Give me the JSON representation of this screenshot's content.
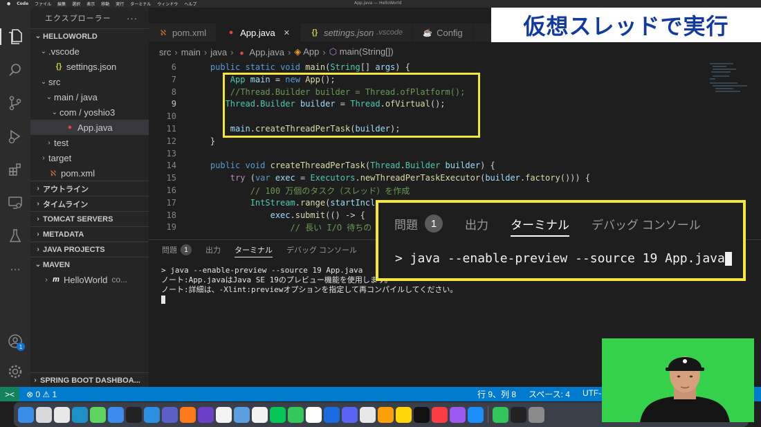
{
  "menubar": {
    "app": "Code",
    "items": [
      "ファイル",
      "編集",
      "選択",
      "表示",
      "移動",
      "実行",
      "ターミナル",
      "ウィンドウ",
      "ヘルプ"
    ],
    "window_title": "App.java — HelloWorld"
  },
  "title_overlay": "仮想スレッドで実行",
  "activity_bar": {
    "items": [
      "files-icon",
      "search-icon",
      "source-control-icon",
      "run-debug-icon",
      "extensions-icon",
      "remote-explorer-icon",
      "testing-icon",
      "more-icon"
    ],
    "account_badge": "1"
  },
  "sidebar": {
    "header": "エクスプローラー",
    "more": "···",
    "tree": [
      {
        "label": "HELLOWORLD",
        "chevron": "⌄",
        "indent": 0,
        "section": true
      },
      {
        "label": ".vscode",
        "chevron": "⌄",
        "indent": 1
      },
      {
        "label": "settings.json",
        "icon": "{}",
        "kind": "json",
        "indent": 2
      },
      {
        "label": "src",
        "chevron": "⌄",
        "indent": 1
      },
      {
        "label": "main / java",
        "chevron": "⌄",
        "indent": 2
      },
      {
        "label": "com / yoshio3",
        "chevron": "⌄",
        "indent": 3
      },
      {
        "label": "App.java",
        "icon": "●",
        "kind": "java",
        "indent": 4,
        "selected": true
      },
      {
        "label": "test",
        "chevron": "›",
        "indent": 2
      },
      {
        "label": "target",
        "chevron": "›",
        "indent": 1
      },
      {
        "label": "pom.xml",
        "icon": "ℵ",
        "kind": "xml",
        "indent": 1
      }
    ],
    "sections": [
      {
        "label": "アウトライン",
        "chevron": "›"
      },
      {
        "label": "タイムライン",
        "chevron": "›"
      },
      {
        "label": "TOMCAT SERVERS",
        "chevron": "›"
      },
      {
        "label": "METADATA",
        "chevron": "›"
      },
      {
        "label": "JAVA PROJECTS",
        "chevron": "›"
      },
      {
        "label": "MAVEN",
        "chevron": "⌄"
      }
    ],
    "maven_item": "HelloWorld",
    "maven_item_suffix": "co...",
    "bottom_section": "SPRING BOOT DASHBOA..."
  },
  "tabs": [
    {
      "label": "pom.xml",
      "icon": "ℵ",
      "kind": "xml"
    },
    {
      "label": "App.java",
      "icon": "●",
      "kind": "java",
      "active": true,
      "close": "✕"
    },
    {
      "label": "settings.json",
      "icon": "{}",
      "kind": "json",
      "suffix": ".vscode",
      "italic": true
    },
    {
      "label": "Config",
      "icon": "☕",
      "kind": "config"
    }
  ],
  "breadcrumb": [
    "src",
    "main",
    "java",
    "App.java",
    "App",
    "main(String[])"
  ],
  "code": {
    "lines": [
      {
        "n": "6",
        "indent": 4,
        "tokens": [
          [
            "kw",
            "public "
          ],
          [
            "kw",
            "static "
          ],
          [
            "kw",
            "void "
          ],
          [
            "fn",
            "main"
          ],
          [
            "tx",
            "("
          ],
          [
            "ty",
            "String"
          ],
          [
            "tx",
            "[] "
          ],
          [
            "va",
            "args"
          ],
          [
            "tx",
            ") {"
          ]
        ]
      },
      {
        "n": "7",
        "indent": 8,
        "tokens": [
          [
            "ty",
            "App "
          ],
          [
            "va",
            "main"
          ],
          [
            "tx",
            " = "
          ],
          [
            "kw",
            "new "
          ],
          [
            "fn",
            "App"
          ],
          [
            "tx",
            "();"
          ]
        ]
      },
      {
        "n": "8",
        "indent": 8,
        "tokens": [
          [
            "cm",
            "//Thread.Builder builder = Thread.ofPlatform();"
          ]
        ]
      },
      {
        "n": "9",
        "indent": 7,
        "cur": true,
        "tokens": [
          [
            "ty",
            "Thread"
          ],
          [
            "tx",
            "."
          ],
          [
            "ty",
            "Builder "
          ],
          [
            "va",
            "builder"
          ],
          [
            "tx",
            " = "
          ],
          [
            "ty",
            "Thread"
          ],
          [
            "tx",
            "."
          ],
          [
            "fn",
            "ofVirtual"
          ],
          [
            "tx",
            "();"
          ]
        ]
      },
      {
        "n": "10",
        "indent": 0,
        "tokens": []
      },
      {
        "n": "11",
        "indent": 8,
        "tokens": [
          [
            "va",
            "main"
          ],
          [
            "tx",
            "."
          ],
          [
            "fn",
            "createThreadPerTask"
          ],
          [
            "tx",
            "("
          ],
          [
            "va",
            "builder"
          ],
          [
            "tx",
            ");"
          ]
        ]
      },
      {
        "n": "12",
        "indent": 4,
        "tokens": [
          [
            "tx",
            "}"
          ]
        ]
      },
      {
        "n": "13",
        "indent": 0,
        "tokens": []
      },
      {
        "n": "14",
        "indent": 4,
        "tokens": [
          [
            "kw",
            "public "
          ],
          [
            "kw",
            "void "
          ],
          [
            "fn",
            "createThreadPerTask"
          ],
          [
            "tx",
            "("
          ],
          [
            "ty",
            "Thread"
          ],
          [
            "tx",
            "."
          ],
          [
            "ty",
            "Builder "
          ],
          [
            "va",
            "builder"
          ],
          [
            "tx",
            ") {"
          ]
        ]
      },
      {
        "n": "15",
        "indent": 8,
        "tokens": [
          [
            "kw2",
            "try "
          ],
          [
            "tx",
            "("
          ],
          [
            "kw",
            "var "
          ],
          [
            "va",
            "exec"
          ],
          [
            "tx",
            " = "
          ],
          [
            "ty",
            "Executors"
          ],
          [
            "tx",
            "."
          ],
          [
            "fn",
            "newThreadPerTaskExecutor"
          ],
          [
            "tx",
            "("
          ],
          [
            "va",
            "builder"
          ],
          [
            "tx",
            "."
          ],
          [
            "fn",
            "factory"
          ],
          [
            "tx",
            "())) {"
          ]
        ]
      },
      {
        "n": "16",
        "indent": 12,
        "tokens": [
          [
            "cm",
            "// 100 万個のタスク（スレッド）を作成"
          ]
        ]
      },
      {
        "n": "17",
        "indent": 12,
        "tokens": [
          [
            "ty",
            "IntStream"
          ],
          [
            "tx",
            "."
          ],
          [
            "fn",
            "range"
          ],
          [
            "tx",
            "("
          ],
          [
            "va",
            "startIncl"
          ]
        ]
      },
      {
        "n": "18",
        "indent": 16,
        "tokens": [
          [
            "va",
            "exec"
          ],
          [
            "tx",
            "."
          ],
          [
            "fn",
            "submit"
          ],
          [
            "tx",
            "(() -> {"
          ]
        ]
      },
      {
        "n": "19",
        "indent": 20,
        "tokens": [
          [
            "cm",
            "// 長い I/O 待ちの"
          ]
        ]
      }
    ]
  },
  "panel": {
    "tabs": [
      {
        "label": "問題",
        "badge": "1"
      },
      {
        "label": "出力"
      },
      {
        "label": "ターミナル",
        "active": true
      },
      {
        "label": "デバッグ コンソール"
      }
    ],
    "terminal_lines": [
      "> java --enable-preview --source 19 App.java",
      "ノート:App.javaはJava SE 19のプレビュー機能を使用します。",
      "ノート:詳細は、-Xlint:previewオプションを指定して再コンパイルしてください。"
    ]
  },
  "zoom": {
    "tabs": [
      {
        "label": "問題",
        "badge": "1"
      },
      {
        "label": "出力"
      },
      {
        "label": "ターミナル",
        "active": true
      },
      {
        "label": "デバッグ コンソール"
      }
    ],
    "command": "> java --enable-preview --source 19 App.java"
  },
  "status": {
    "remote": "><",
    "problems": "⊗ 0 ⚠ 1",
    "position": "行 9、列 8",
    "spaces": "スペース: 4",
    "encoding": "UTF-"
  },
  "dock": {
    "apps": [
      {
        "name": "finder",
        "color": "#3b8ee8"
      },
      {
        "name": "launchpad",
        "color": "#d8d8d8"
      },
      {
        "name": "chrome",
        "color": "#e8e8e8"
      },
      {
        "name": "edge",
        "color": "#1e90c8"
      },
      {
        "name": "messages",
        "color": "#5fd35f"
      },
      {
        "name": "mail",
        "color": "#3e8bf0"
      },
      {
        "name": "terminal",
        "color": "#222222"
      },
      {
        "name": "vscode",
        "color": "#2d8fe0"
      },
      {
        "name": "teams",
        "color": "#5b5fc7"
      },
      {
        "name": "firefox",
        "color": "#ff7a1a"
      },
      {
        "name": "github",
        "color": "#6e40c9"
      },
      {
        "name": "textedit",
        "color": "#f3f3f3"
      },
      {
        "name": "preview",
        "color": "#5aa0e0"
      },
      {
        "name": "photos",
        "color": "#f2f2f2"
      },
      {
        "name": "line",
        "color": "#06c755"
      },
      {
        "name": "facetime",
        "color": "#34c759"
      },
      {
        "name": "calendar",
        "color": "#ffffff"
      },
      {
        "name": "keynote",
        "color": "#1a6be0"
      },
      {
        "name": "discord",
        "color": "#5865f2"
      },
      {
        "name": "slack",
        "color": "#e8e8e8"
      },
      {
        "name": "books",
        "color": "#ff9f0a"
      },
      {
        "name": "notes",
        "color": "#ffd60a"
      },
      {
        "name": "tv",
        "color": "#111111"
      },
      {
        "name": "music",
        "color": "#fc3c44"
      },
      {
        "name": "podcasts",
        "color": "#9b59f0"
      },
      {
        "name": "appstore",
        "color": "#1c8ef9"
      },
      {
        "name": "numbers",
        "color": "#31c55a"
      },
      {
        "name": "stocks",
        "color": "#222222"
      },
      {
        "name": "settings",
        "color": "#8a8a8a"
      }
    ]
  }
}
